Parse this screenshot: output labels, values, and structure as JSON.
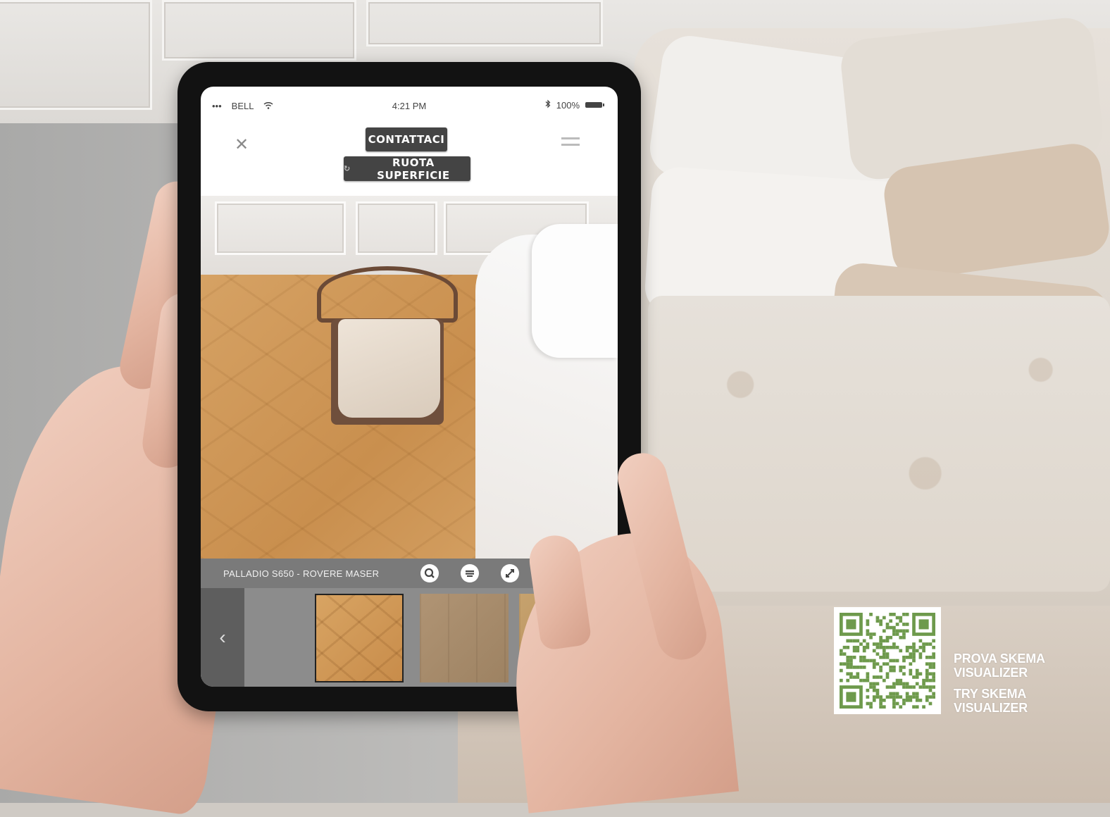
{
  "status_bar": {
    "signal": "•••",
    "carrier": "BELL",
    "time": "4:21 PM",
    "bluetooth": "bluetooth-icon",
    "battery_label": "100%"
  },
  "app_bar": {
    "close_icon": "close-icon",
    "menu_icon": "menu-icon",
    "contact_button": "CONTATTACI",
    "rotate_button": "RUOTA SUPERFICIE"
  },
  "product": {
    "name": "PALLADIO S650 - ROVERE MASER"
  },
  "tools": [
    "search-icon",
    "layers-icon",
    "resize-icon"
  ],
  "carousel": {
    "prev": "‹",
    "next": "›",
    "selected_index": 0
  },
  "promo": {
    "line1a": "PROVA SKEMA",
    "line1b": "VISUALIZER",
    "line2a": "TRY SKEMA",
    "line2b": "VISUALIZER",
    "qr_color": "#6e9a4c"
  }
}
